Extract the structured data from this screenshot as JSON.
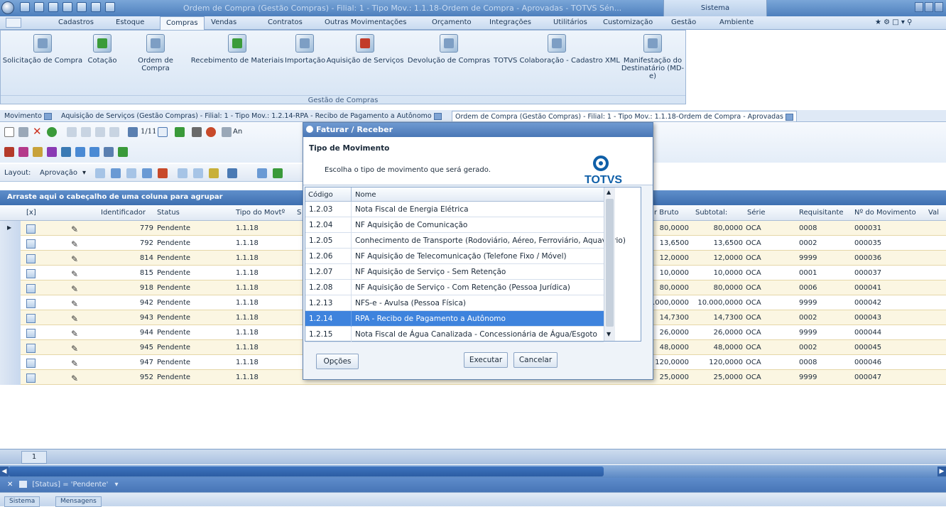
{
  "window": {
    "title": "Ordem de Compra (Gestão Compras) - Filial: 1 - Tipo Mov.: 1.1.18-Ordem de Compra - Aprovadas - TOTVS Sén...",
    "system_tab": "Sistema"
  },
  "menu": [
    "Cadastros",
    "Estoque",
    "Compras",
    "Vendas",
    "Contratos",
    "Outras Movimentações",
    "Orçamento",
    "Integrações",
    "Utilitários",
    "Customização",
    "Gestão",
    "Ambiente"
  ],
  "ribbon": {
    "buttons": [
      "Solicitação de Compra",
      "Cotação",
      "Ordem de Compra",
      "Recebimento de Materiais",
      "Importação",
      "Aquisição de Serviços",
      "Devolução de Compras",
      "TOTVS Colaboração - Cadastro XML"
    ],
    "last_button_line1": "Manifestação do",
    "last_button_line2": "Destinatário (MD-e)",
    "group_label": "Gestão de Compras"
  },
  "doc_tabs": {
    "movimento": "Movimento",
    "tab1": "Aquisição de Serviços (Gestão Compras) - Filial: 1 - Tipo Mov.: 1.2.14-RPA - Recibo de Pagamento a Autônomo",
    "tab2": "Ordem de Compra (Gestão Compras) - Filial: 1 - Tipo Mov.: 1.1.18-Ordem de Compra - Aprovadas"
  },
  "toolbar": {
    "record_counter": "1/11",
    "layout_label": "Layout:",
    "layout_value": "Aprovação",
    "an_label": "An"
  },
  "grid": {
    "group_hint": "Arraste aqui o cabeçalho de uma coluna para agrupar",
    "columns": {
      "sel": "[x]",
      "id": "Identificador",
      "status": "Status",
      "tipo": "Tipo do Movtº",
      "s": "S",
      "vbruto": "r Bruto",
      "subtotal": "Subtotal:",
      "serie": "Série",
      "requisitante": "Requisitante",
      "nmov": "Nº do Movimento",
      "val": "Val"
    },
    "rows": [
      {
        "id": "779",
        "status": "Pendente",
        "tipo": "1.1.18",
        "vbruto": "80,0000",
        "subtotal": "80,0000",
        "serie": "OCA",
        "req": "0008",
        "nmov": "000031"
      },
      {
        "id": "792",
        "status": "Pendente",
        "tipo": "1.1.18",
        "vbruto": "13,6500",
        "subtotal": "13,6500",
        "serie": "OCA",
        "req": "0002",
        "nmov": "000035"
      },
      {
        "id": "814",
        "status": "Pendente",
        "tipo": "1.1.18",
        "vbruto": "12,0000",
        "subtotal": "12,0000",
        "serie": "OCA",
        "req": "9999",
        "nmov": "000036"
      },
      {
        "id": "815",
        "status": "Pendente",
        "tipo": "1.1.18",
        "vbruto": "10,0000",
        "subtotal": "10,0000",
        "serie": "OCA",
        "req": "0001",
        "nmov": "000037"
      },
      {
        "id": "918",
        "status": "Pendente",
        "tipo": "1.1.18",
        "vbruto": "80,0000",
        "subtotal": "80,0000",
        "serie": "OCA",
        "req": "0006",
        "nmov": "000041"
      },
      {
        "id": "942",
        "status": "Pendente",
        "tipo": "1.1.18",
        "vbruto": ".000,0000",
        "subtotal": "10.000,0000",
        "serie": "OCA",
        "req": "9999",
        "nmov": "000042"
      },
      {
        "id": "943",
        "status": "Pendente",
        "tipo": "1.1.18",
        "vbruto": "14,7300",
        "subtotal": "14,7300",
        "serie": "OCA",
        "req": "0002",
        "nmov": "000043"
      },
      {
        "id": "944",
        "status": "Pendente",
        "tipo": "1.1.18",
        "vbruto": "26,0000",
        "subtotal": "26,0000",
        "serie": "OCA",
        "req": "9999",
        "nmov": "000044"
      },
      {
        "id": "945",
        "status": "Pendente",
        "tipo": "1.1.18",
        "vbruto": "48,0000",
        "subtotal": "48,0000",
        "serie": "OCA",
        "req": "0002",
        "nmov": "000045"
      },
      {
        "id": "947",
        "status": "Pendente",
        "tipo": "1.1.18",
        "vbruto": "120,0000",
        "subtotal": "120,0000",
        "serie": "OCA",
        "req": "0008",
        "nmov": "000046"
      },
      {
        "id": "952",
        "status": "Pendente",
        "tipo": "1.1.18",
        "vbruto": "25,0000",
        "subtotal": "25,0000",
        "serie": "OCA",
        "req": "9999",
        "nmov": "000047"
      }
    ],
    "page": "1",
    "filter": "[Status] = 'Pendente'"
  },
  "statusbar": {
    "tab1": "Sistema",
    "tab2": "Mensagens"
  },
  "dialog": {
    "title": "Faturar / Receber",
    "heading": "Tipo de Movimento",
    "description": "Escolha o tipo de movimento que será gerado.",
    "brand": "TOTVS",
    "col_code": "Código",
    "col_name": "Nome",
    "items": [
      {
        "code": "1.2.03",
        "name": "Nota Fiscal de Energia Elétrica"
      },
      {
        "code": "1.2.04",
        "name": "NF Aquisição de Comunicação"
      },
      {
        "code": "1.2.05",
        "name": "Conhecimento de Transporte (Rodoviário, Aéreo, Ferroviário, Aquaviário)"
      },
      {
        "code": "1.2.06",
        "name": "NF Aquisição de Telecomunicação (Telefone Fixo / Móvel)"
      },
      {
        "code": "1.2.07",
        "name": "NF Aquisição de Serviço - Sem Retenção"
      },
      {
        "code": "1.2.08",
        "name": "NF Aquisição de Serviço - Com Retenção (Pessoa Jurídica)"
      },
      {
        "code": "1.2.13",
        "name": "NFS-e - Avulsa (Pessoa Física)"
      },
      {
        "code": "1.2.14",
        "name": "RPA - Recibo de Pagamento a Autônomo"
      },
      {
        "code": "1.2.15",
        "name": "Nota Fiscal de Água Canalizada - Concessionária de Água/Esgoto"
      }
    ],
    "selected_index": 7,
    "btn_options": "Opções",
    "btn_execute": "Executar",
    "btn_cancel": "Cancelar"
  },
  "colors": {
    "accent": "#3e83dd",
    "header_band": "#4d7fbd",
    "row_alt": "#fbf6e2"
  }
}
